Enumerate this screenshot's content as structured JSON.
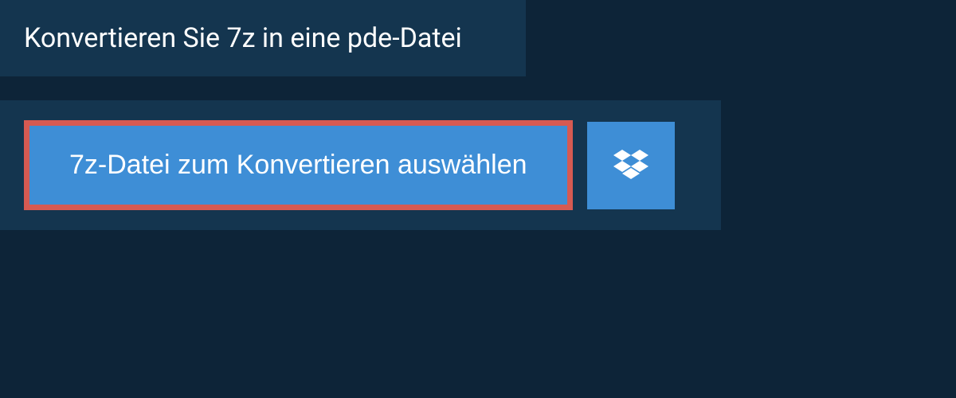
{
  "header": {
    "title": "Konvertieren Sie 7z in eine pde-Datei"
  },
  "actions": {
    "select_file_label": "7z-Datei zum Konvertieren auswählen"
  },
  "colors": {
    "background": "#0d2438",
    "panel": "#14354f",
    "button": "#3e8ed6",
    "highlight_border": "#d65a52"
  }
}
